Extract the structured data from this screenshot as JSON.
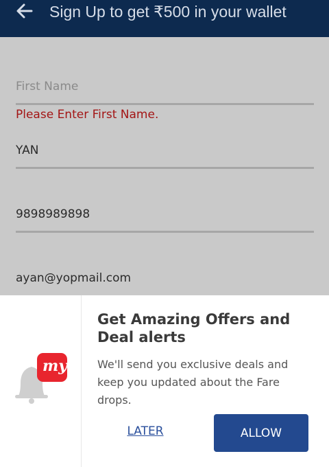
{
  "header": {
    "title": "Sign Up to get ₹500 in your wallet",
    "back_icon": "arrow-left-icon"
  },
  "form": {
    "first_name": {
      "placeholder": "First Name",
      "value": ""
    },
    "error": "Please Enter First Name.",
    "last_name": {
      "value": "YAN"
    },
    "phone": {
      "value": "9898989898"
    },
    "email": {
      "value": "ayan@yopmail.com"
    }
  },
  "notification_prompt": {
    "title": "Get Amazing Offers and Deal alerts",
    "body": "We'll send you exclusive deals and keep you updated about the Fare drops.",
    "later_label": "LATER",
    "allow_label": "ALLOW",
    "icon": "bell-icon",
    "logo_text": "my"
  },
  "colors": {
    "header_bg": "#0d2a4f",
    "error": "#a31515",
    "accent": "#23498f",
    "logo_red": "#e8252e"
  }
}
